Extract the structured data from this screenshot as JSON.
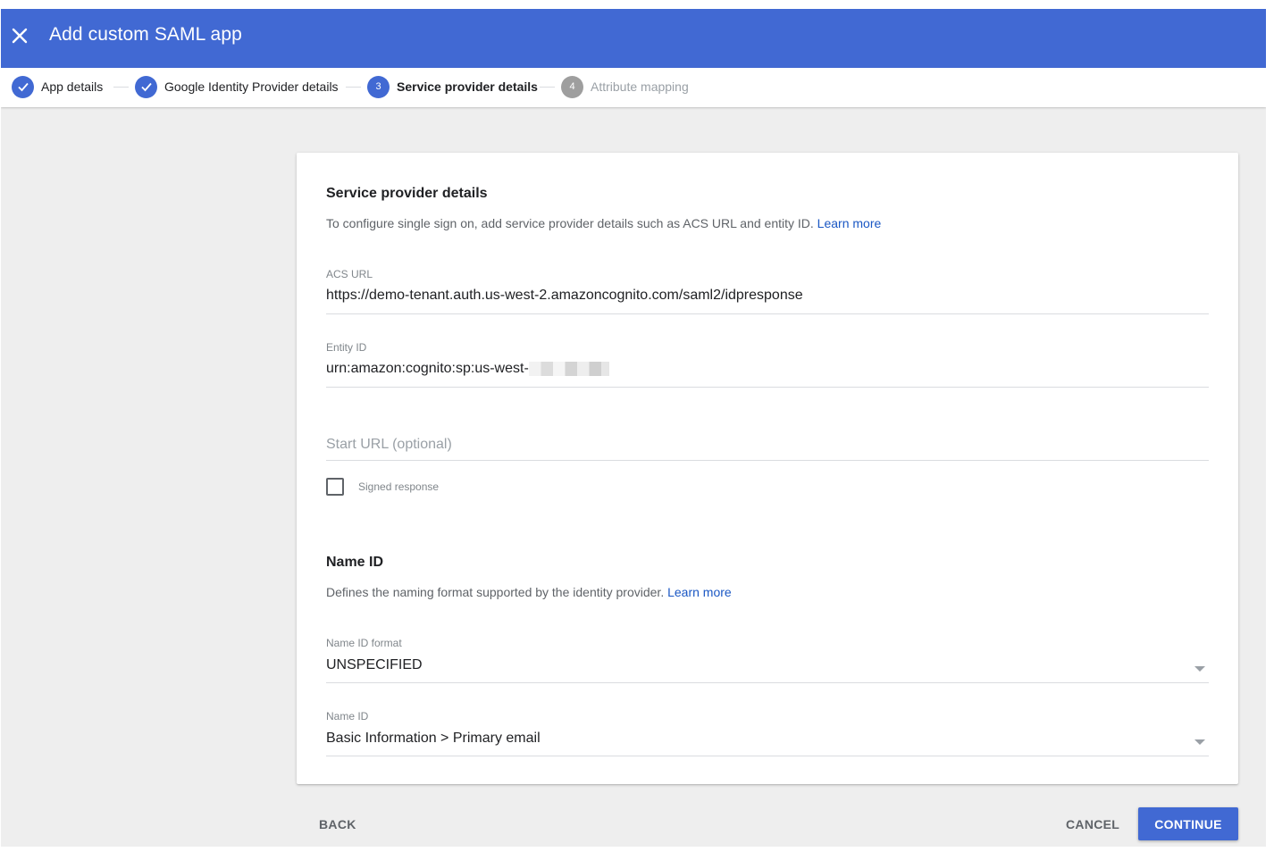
{
  "header": {
    "title": "Add custom SAML app",
    "close_icon": "close-icon"
  },
  "stepper": {
    "steps": [
      {
        "label": "App details",
        "state": "done"
      },
      {
        "label": "Google Identity Provider details",
        "state": "done"
      },
      {
        "number": "3",
        "label": "Service provider details",
        "state": "current"
      },
      {
        "number": "4",
        "label": "Attribute mapping",
        "state": "future"
      }
    ]
  },
  "service_provider": {
    "title": "Service provider details",
    "description": "To configure single sign on, add service provider details such as ACS URL and entity ID.",
    "learn_more": "Learn more",
    "acs_url": {
      "label": "ACS URL",
      "value": "https://demo-tenant.auth.us-west-2.amazoncognito.com/saml2/idpresponse"
    },
    "entity_id": {
      "label": "Entity ID",
      "value": "urn:amazon:cognito:sp:us-west-"
    },
    "start_url": {
      "placeholder": "Start URL (optional)",
      "value": ""
    },
    "signed_response": {
      "label": "Signed response",
      "checked": false
    }
  },
  "name_id_section": {
    "title": "Name ID",
    "description": "Defines the naming format supported by the identity provider.",
    "learn_more": "Learn more",
    "name_id_format": {
      "label": "Name ID format",
      "value": "UNSPECIFIED"
    },
    "name_id": {
      "label": "Name ID",
      "value": "Basic Information > Primary email"
    }
  },
  "footer": {
    "back": "BACK",
    "cancel": "CANCEL",
    "continue": "CONTINUE"
  },
  "colors": {
    "brand": "#4169d3",
    "link": "#1a57c4",
    "page_bg": "#eeeeee"
  }
}
